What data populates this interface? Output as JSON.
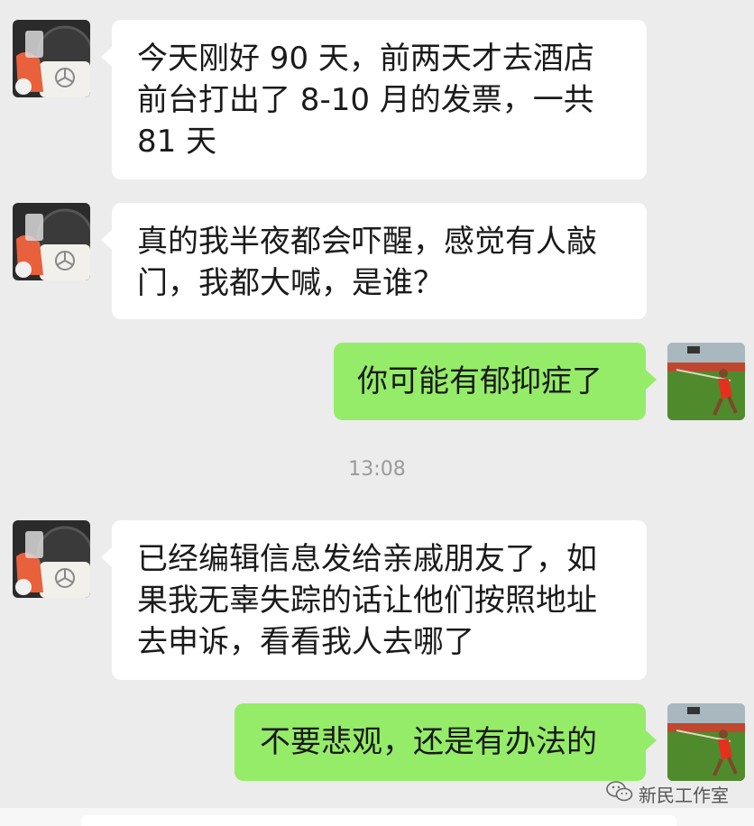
{
  "messages": [
    {
      "text": "今天刚好 90 天，前两天才去酒店前台打出了 8-10 月的发票，一共 81 天"
    },
    {
      "text": "真的我半夜都会吓醒，感觉有人敲门，我都大喊，是谁？"
    },
    {
      "text": "你可能有郁抑症了"
    },
    {
      "text": "已经编辑信息发给亲戚朋友了，如果我无辜失踪的话让他们按照地址去申诉，看看我人去哪了"
    },
    {
      "text": "不要悲观，还是有办法的"
    }
  ],
  "timestamp": "13:08",
  "watermark": {
    "icon": "wechat-icon",
    "text": "新民工作室"
  },
  "colors": {
    "background": "#ececec",
    "incoming_bubble": "#ffffff",
    "outgoing_bubble": "#95ec69"
  },
  "avatars": {
    "contact": "car-interior-avatar",
    "self": "athlete-avatar"
  }
}
